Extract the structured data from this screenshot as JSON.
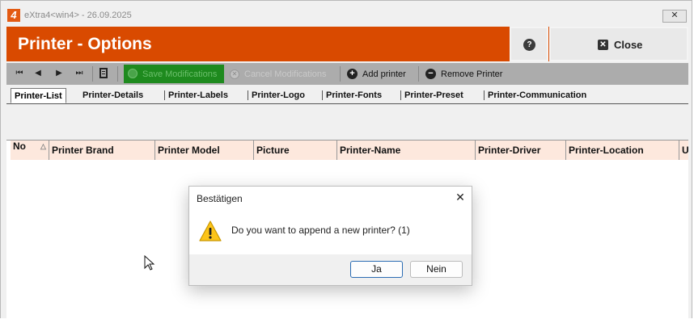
{
  "window": {
    "title": "eXtra4<win4>  -  26.09.2025"
  },
  "header": {
    "title": "Printer - Options",
    "help": "?",
    "close_label": "Close"
  },
  "toolbar": {
    "save_label": "Save Modifications",
    "cancel_label": "Cancel Modifications",
    "add_label": "Add printer",
    "remove_label": "Remove Printer"
  },
  "tabs": [
    "Printer-List",
    "Printer-Details",
    "Printer-Labels",
    "Printer-Logo",
    "Printer-Fonts",
    "Printer-Preset",
    "Printer-Communication"
  ],
  "columns": [
    "No",
    "Printer Brand",
    "Printer Model",
    "Picture",
    "Printer-Name",
    "Printer-Driver",
    "Printer-Location",
    "U"
  ],
  "dialog": {
    "title": "Bestätigen",
    "message": "Do you want to append a new printer? (1)",
    "yes": "Ja",
    "no": "Nein"
  },
  "colors": {
    "header": "#d94a00",
    "save": "#1e8a1e",
    "column_header": "#fde8dd"
  }
}
